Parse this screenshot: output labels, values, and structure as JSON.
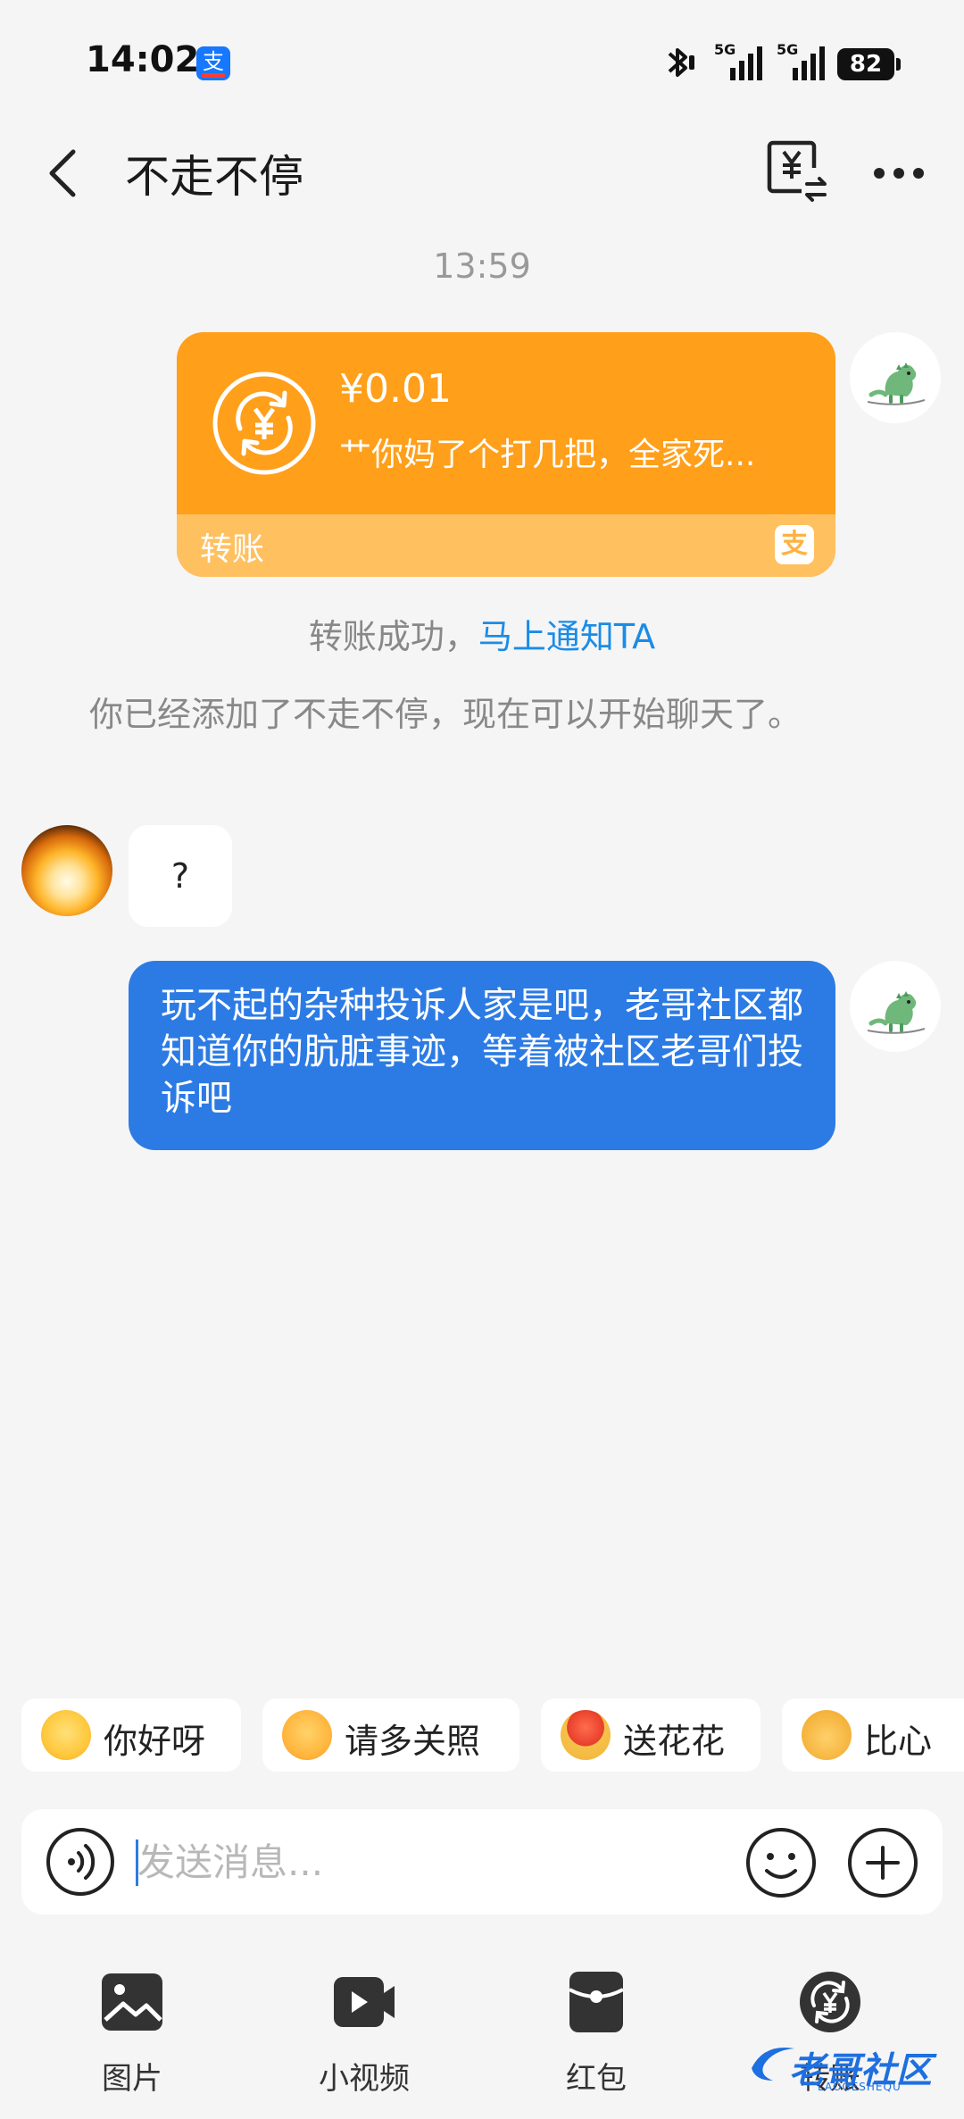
{
  "status_bar": {
    "time": "14:02",
    "app_badge": "支",
    "network_1": "5G",
    "network_2": "5G",
    "battery": "82"
  },
  "header": {
    "title": "不走不停"
  },
  "chat": {
    "timestamp": "13:59",
    "transfer_card": {
      "amount": "¥0.01",
      "memo": "艹你妈了个打几把，全家死...",
      "label": "转账",
      "logo": "支"
    },
    "transfer_status": {
      "text": "转账成功，",
      "link": "马上通知TA"
    },
    "friend_notice": "你已经添加了不走不停，现在可以开始聊天了。",
    "messages": [
      {
        "side": "left",
        "text": "?"
      },
      {
        "side": "right",
        "text": "玩不起的杂种投诉人家是吧，老哥社区都知道你的肮脏事迹，等着被社区老哥们投诉吧"
      }
    ]
  },
  "quick_replies": [
    {
      "label": "你好呀",
      "icon": "smile-emoji"
    },
    {
      "label": "请多关照",
      "icon": "hug-emoji"
    },
    {
      "label": "送花花",
      "icon": "flower-emoji"
    },
    {
      "label": "比心",
      "icon": "finger-heart-emoji"
    }
  ],
  "input": {
    "placeholder": "发送消息...",
    "value": ""
  },
  "toolbar": [
    {
      "label": "图片",
      "icon": "image-icon"
    },
    {
      "label": "小视频",
      "icon": "video-icon"
    },
    {
      "label": "红包",
      "icon": "red-packet-icon"
    },
    {
      "label": "转账",
      "icon": "transfer-icon"
    }
  ],
  "watermark": {
    "text": "老哥社区",
    "sub": "LAOGESHEQU"
  },
  "colors": {
    "accent_blue": "#2c7be5",
    "transfer_orange": "#ff9f1a",
    "transfer_orange_light": "#ffc060",
    "link_blue": "#1a8ce8"
  }
}
